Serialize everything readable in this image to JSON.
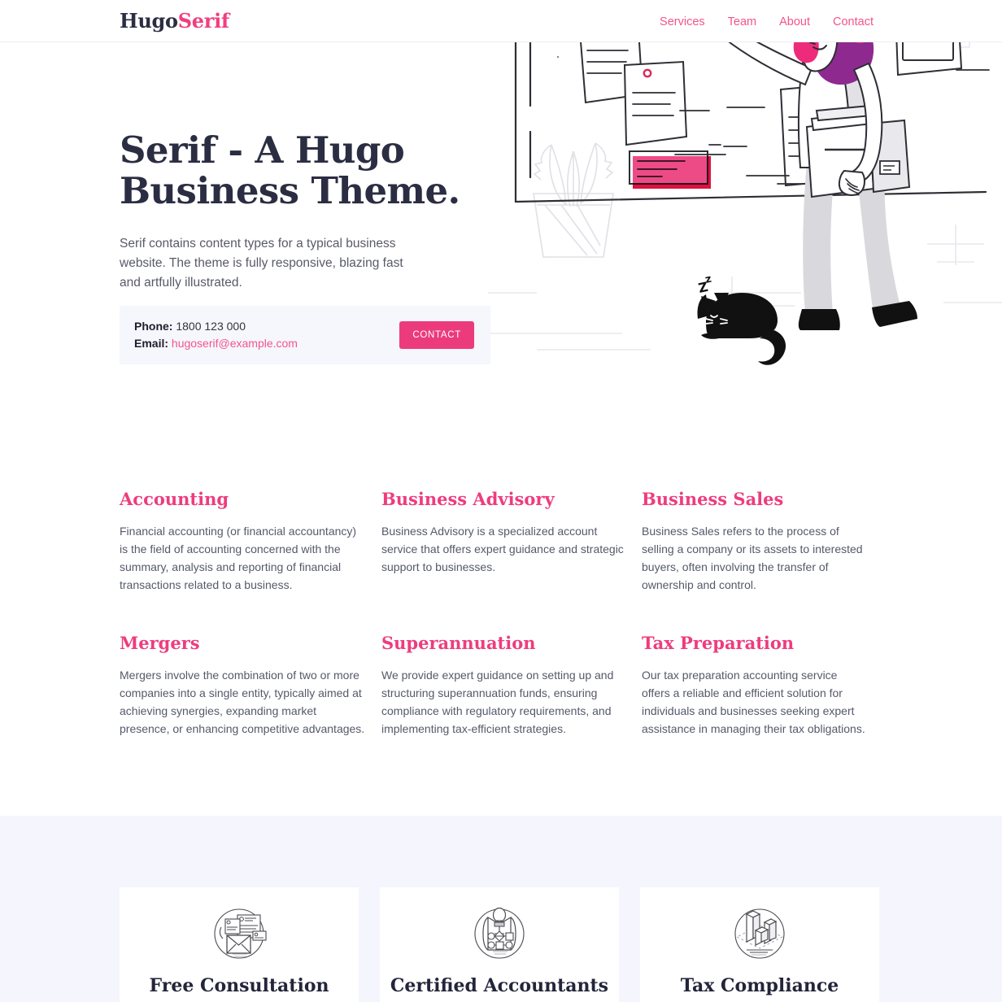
{
  "brand": {
    "name_first": "Hugo",
    "name_second": "Serif",
    "accent_color": "#ef3f7f",
    "dark_color": "#2b2d42"
  },
  "nav": {
    "items": [
      {
        "label": "Services"
      },
      {
        "label": "Team"
      },
      {
        "label": "About"
      },
      {
        "label": "Contact"
      }
    ]
  },
  "hero": {
    "title_line1": "Serif - A Hugo",
    "title_line2": "Business Theme.",
    "subtitle": "Serif contains content types for a typical business website. The theme is fully responsive, blazing fast and artfully illustrated.",
    "contact": {
      "phone_label": "Phone:",
      "phone_value": "1800 123 000",
      "email_label": "Email:",
      "email_value": "hugoserif@example.com",
      "button_label": "CONTACT",
      "button_color": "#ec3b7c",
      "box_background": "#f6f6fd"
    },
    "illustration": {
      "name": "woman-with-folders-and-pinboard",
      "elements": [
        "pinboard",
        "pinned-papers",
        "pink-sticky-note",
        "checklist",
        "woman-pointing",
        "folders",
        "potted-plant",
        "sleeping-cat"
      ]
    }
  },
  "services": [
    {
      "title": "Accounting",
      "body": "Financial accounting (or financial accountancy) is the field of accounting concerned with the summary, analysis and reporting of financial transactions related to a business."
    },
    {
      "title": "Business Advisory",
      "body": "Business Advisory is a specialized account service that offers expert guidance and strategic support to businesses."
    },
    {
      "title": "Business Sales",
      "body": "Business Sales refers to the process of selling a company or its assets to interested buyers, often involving the transfer of ownership and control."
    },
    {
      "title": "Mergers",
      "body": "Mergers involve the combination of two or more companies into a single entity, typically aimed at achieving synergies, expanding market presence, or enhancing competitive advantages."
    },
    {
      "title": "Superannuation",
      "body": "We provide expert guidance on setting up and structuring superannuation funds, ensuring compliance with regulatory requirements, and implementing tax-efficient strategies."
    },
    {
      "title": "Tax Preparation",
      "body": "Our tax preparation accounting service offers a reliable and efficient solution for individuals and businesses seeking expert assistance in managing their tax obligations."
    }
  ],
  "features": {
    "background": "#f5f5fd",
    "cards": [
      {
        "title": "Free Consultation",
        "icon": "mail-documents-icon"
      },
      {
        "title": "Certified Accountants",
        "icon": "lightbulb-flowchart-icon"
      },
      {
        "title": "Tax Compliance",
        "icon": "bar-chart-3d-icon"
      }
    ]
  }
}
